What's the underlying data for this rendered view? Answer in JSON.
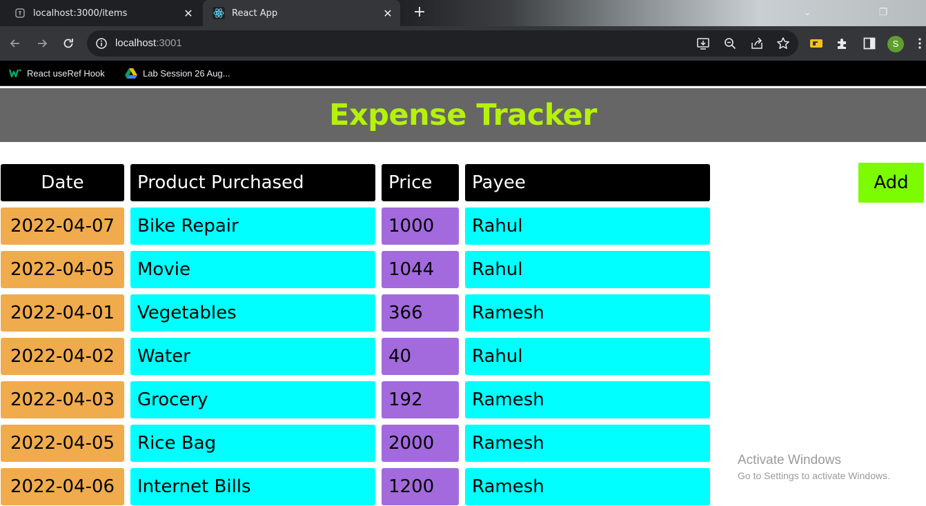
{
  "browser": {
    "tabs": [
      {
        "title": "localhost:3000/items",
        "active": false,
        "favicon": "loading-page-icon"
      },
      {
        "title": "React App",
        "active": true,
        "favicon": "react-logo-icon"
      }
    ],
    "url_host": "localhost",
    "url_port": ":3001",
    "profile_initial": "S",
    "bookmarks": [
      {
        "label": "React useRef Hook",
        "icon": "w3schools-icon"
      },
      {
        "label": "Lab Session 26 Aug...",
        "icon": "google-drive-icon"
      }
    ]
  },
  "app": {
    "title": "Expense Tracker",
    "add_label": "Add",
    "table": {
      "headers": {
        "date": "Date",
        "product": "Product Purchased",
        "price": "Price",
        "payee": "Payee"
      },
      "rows": [
        {
          "date": "2022-04-07",
          "product": "Bike Repair",
          "price": "1000",
          "payee": "Rahul"
        },
        {
          "date": "2022-04-05",
          "product": "Movie",
          "price": "1044",
          "payee": "Rahul"
        },
        {
          "date": "2022-04-01",
          "product": "Vegetables",
          "price": "366",
          "payee": "Ramesh"
        },
        {
          "date": "2022-04-02",
          "product": "Water",
          "price": "40",
          "payee": "Rahul"
        },
        {
          "date": "2022-04-03",
          "product": "Grocery",
          "price": "192",
          "payee": "Ramesh"
        },
        {
          "date": "2022-04-05",
          "product": "Rice Bag",
          "price": "2000",
          "payee": "Ramesh"
        },
        {
          "date": "2022-04-06",
          "product": "Internet Bills",
          "price": "1200",
          "payee": "Ramesh"
        }
      ]
    }
  },
  "watermark": {
    "line1": "Activate Windows",
    "line2": "Go to Settings to activate Windows."
  },
  "colors": {
    "header_bg": "#666666",
    "title": "#b5f20a",
    "date_cell": "#f0ab4d",
    "text_cell": "#00ffff",
    "price_cell": "#a36add",
    "add_button": "#7cfc00"
  }
}
